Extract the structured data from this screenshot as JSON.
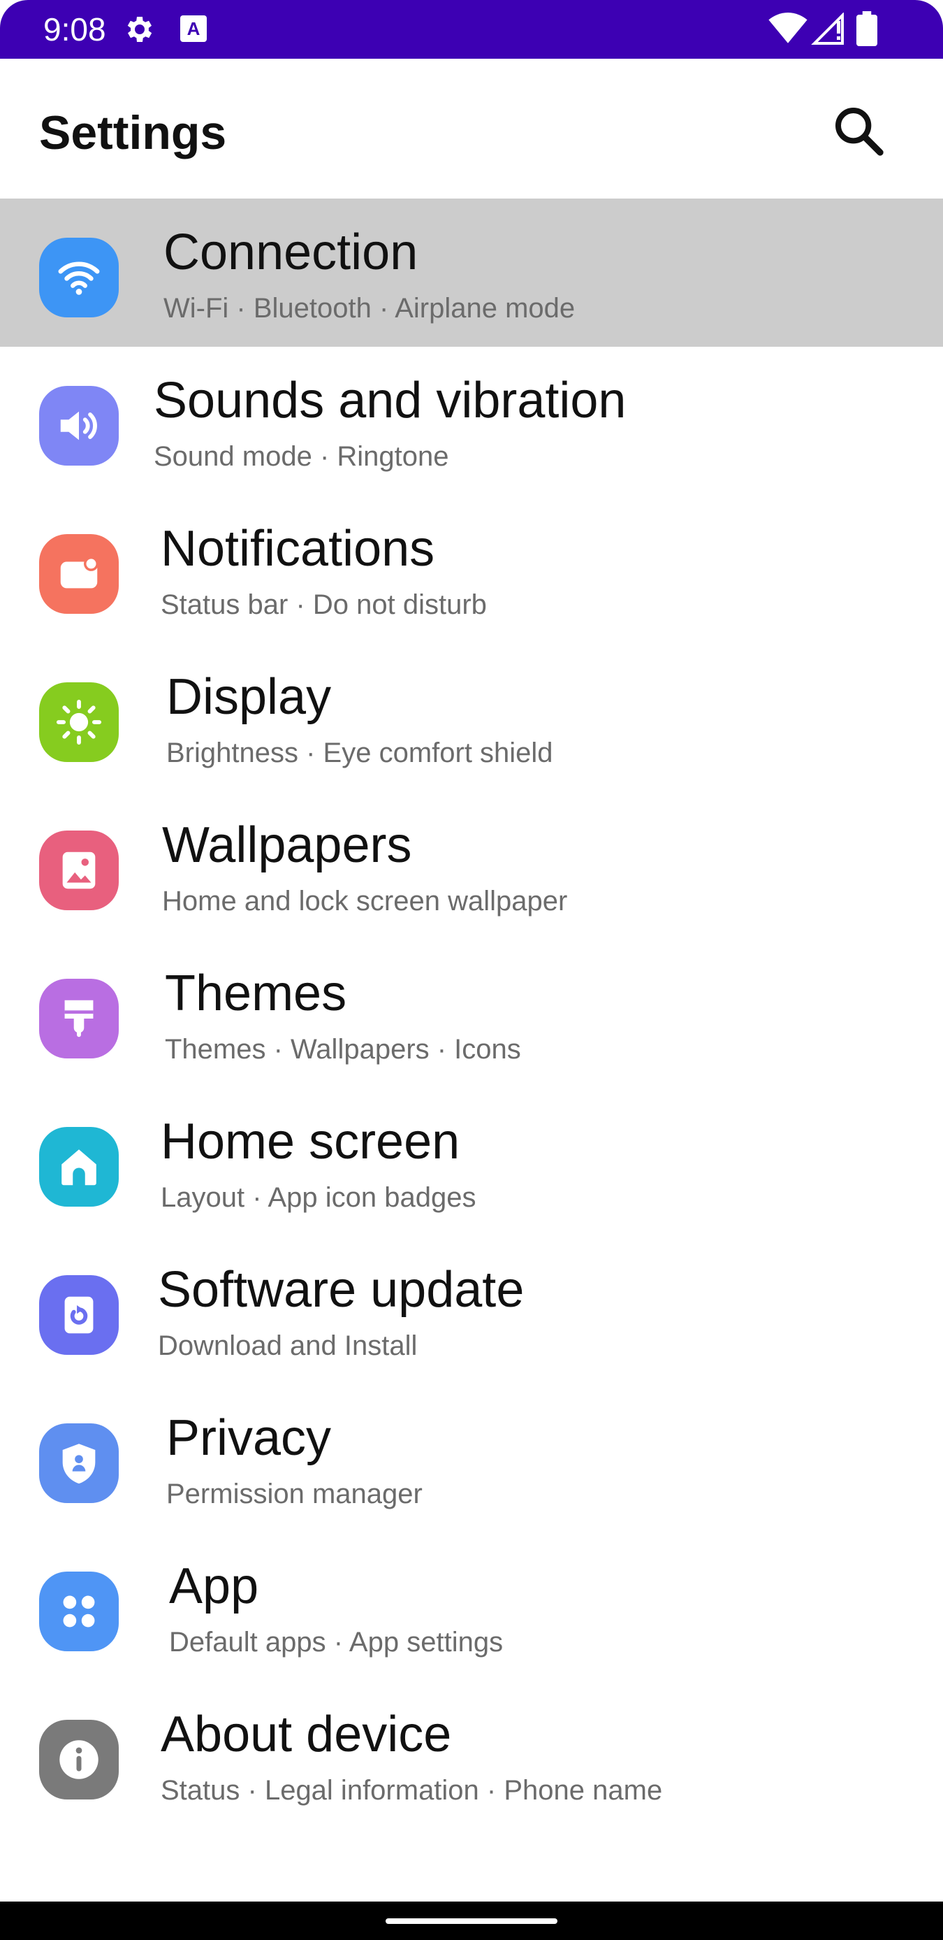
{
  "status_bar": {
    "time": "9:08",
    "background": "#3d00b3",
    "icons": [
      "gear-icon",
      "keyboard-a-icon",
      "wifi-icon",
      "signal-icon",
      "battery-icon"
    ],
    "keyboard_letter": "A"
  },
  "header": {
    "title": "Settings",
    "search_icon": "search-icon"
  },
  "settings": [
    {
      "title": "Connection",
      "subtitle": "Wi-Fi · Bluetooth · Airplane mode",
      "icon": "wifi-icon",
      "color": "#3d95f5",
      "selected": true
    },
    {
      "title": "Sounds and vibration",
      "subtitle": "Sound mode · Ringtone",
      "icon": "speaker-icon",
      "color": "#7f86f5"
    },
    {
      "title": "Notifications",
      "subtitle": "Status bar · Do not disturb",
      "icon": "notification-icon",
      "color": "#f5735f"
    },
    {
      "title": "Display",
      "subtitle": "Brightness · Eye comfort shield",
      "icon": "sun-icon",
      "color": "#86cc1f"
    },
    {
      "title": "Wallpapers",
      "subtitle": "Home and lock screen wallpaper",
      "icon": "image-icon",
      "color": "#e8607e"
    },
    {
      "title": "Themes",
      "subtitle": "Themes · Wallpapers · Icons",
      "icon": "brush-icon",
      "color": "#b96ee2"
    },
    {
      "title": "Home screen",
      "subtitle": "Layout · App icon badges",
      "icon": "home-icon",
      "color": "#1fb7d4"
    },
    {
      "title": "Software update",
      "subtitle": "Download and Install",
      "icon": "update-icon",
      "color": "#6a6ff0"
    },
    {
      "title": "Privacy",
      "subtitle": "Permission manager",
      "icon": "shield-icon",
      "color": "#5f8ff0"
    },
    {
      "title": "App",
      "subtitle": "Default apps · App settings",
      "icon": "apps-grid-icon",
      "color": "#4f95f5"
    },
    {
      "title": "About device",
      "subtitle": "Status · Legal information · Phone name",
      "icon": "info-icon",
      "color": "#7a7a7a"
    }
  ]
}
